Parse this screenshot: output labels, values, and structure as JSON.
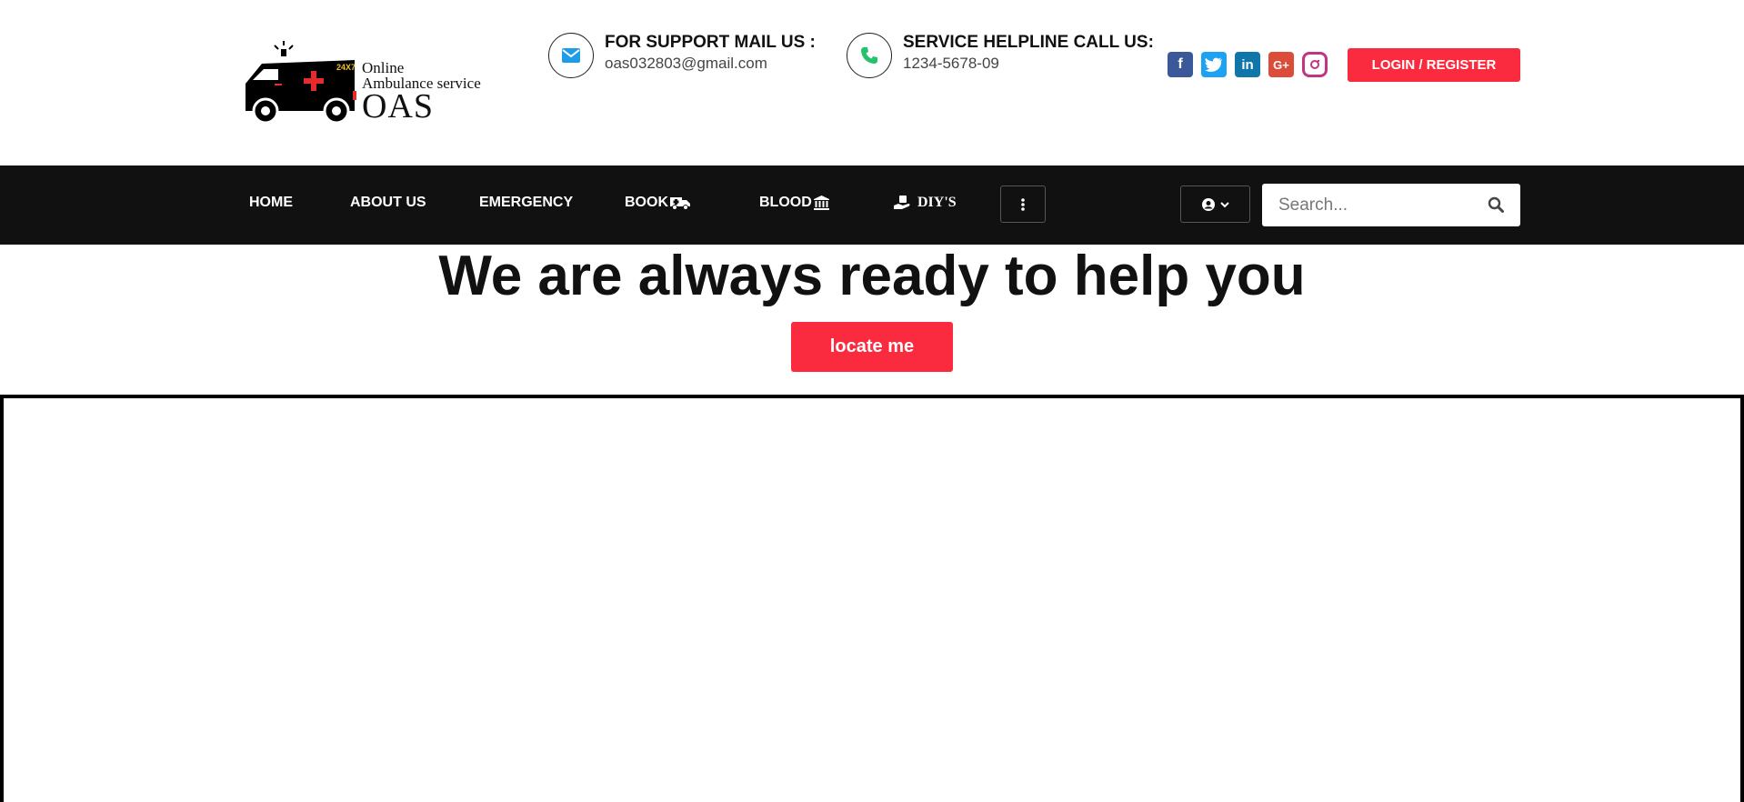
{
  "header": {
    "logo": {
      "line1": "Online",
      "line2": "Ambulance service",
      "line3": "OAS",
      "badge": "24X7"
    },
    "support": {
      "title": "FOR SUPPORT MAIL US :",
      "value": "oas032803@gmail.com",
      "icon": "envelope-icon",
      "icon_color": "#1e9be9"
    },
    "helpline": {
      "title": "SERVICE HELPLINE CALL US:",
      "value": "1234-5678-09",
      "icon": "phone-icon",
      "icon_color": "#25c26e"
    },
    "socials": [
      "facebook-icon",
      "twitter-icon",
      "linkedin-icon",
      "google-plus-icon",
      "instagram-icon"
    ],
    "login_label": "LOGIN / REGISTER"
  },
  "nav": {
    "items": [
      {
        "label": "HOME"
      },
      {
        "label": "ABOUT US"
      },
      {
        "label": "EMERGENCY"
      },
      {
        "label": "BOOK",
        "icon": "ambulance-icon"
      },
      {
        "label": "BLOOD",
        "icon": "bank-icon"
      },
      {
        "label": "DIY'S",
        "icon": "hand-holding-icon"
      }
    ],
    "more_icon": "vertical-ellipsis-icon",
    "user_icon": "user-circle-icon",
    "search_placeholder": "Search..."
  },
  "hero": {
    "title": "We are always ready to help you",
    "button_label": "locate me"
  },
  "colors": {
    "accent": "#fa2a3f",
    "navbar": "#111111",
    "settings_tab": "#e53935"
  }
}
